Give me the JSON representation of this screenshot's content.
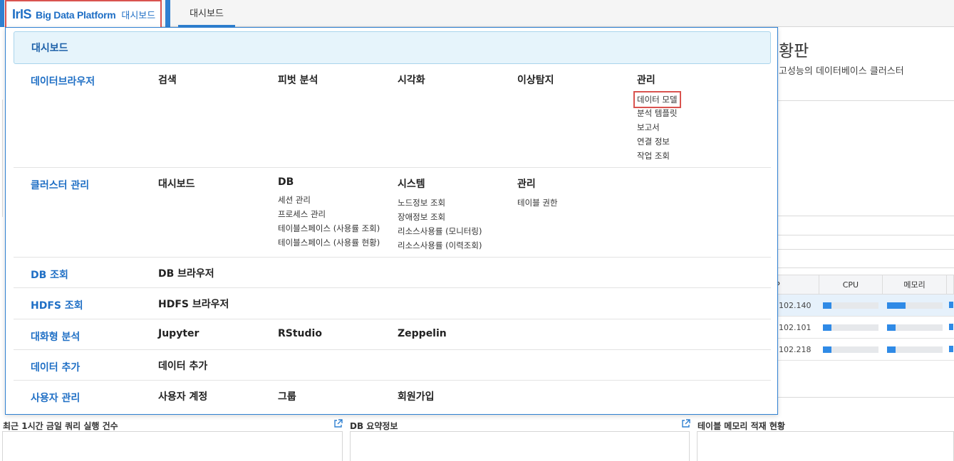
{
  "app": {
    "logo_text": "IrIS",
    "name": "Big Data Platform",
    "page": "대시보드"
  },
  "tabs": [
    {
      "label": "대시보드",
      "active": true
    }
  ],
  "colors": {
    "accent": "#2f80d1",
    "highlight": "#d9534f",
    "header_bg": "#e6f4fb",
    "section_title": "#1f6fc5"
  },
  "background": {
    "title_fragment": "황판",
    "subtitle_fragment": "고성능의 데이터베이스 클러스터",
    "table": {
      "columns": [
        "P",
        "CPU",
        "메모리"
      ],
      "rows": [
        {
          "ip": ".102.140",
          "cpu": 0.15,
          "mem": 0.33,
          "selected": true
        },
        {
          "ip": ".102.101",
          "cpu": 0.15,
          "mem": 0.15,
          "selected": false
        },
        {
          "ip": ".102.218",
          "cpu": 0.15,
          "mem": 0.15,
          "selected": false
        }
      ]
    },
    "panels": [
      {
        "title": "최근 1시간 금일 쿼리 실행 건수"
      },
      {
        "title": "DB 요약정보"
      },
      {
        "title": "테이블 메모리 적재 현황"
      }
    ]
  },
  "menu": {
    "header": "대시보드",
    "sections": [
      {
        "title": "데이터브라우저",
        "columns": [
          {
            "head": "검색",
            "items": []
          },
          {
            "head": "피벗 분석",
            "items": []
          },
          {
            "head": "시각화",
            "items": []
          },
          {
            "head": "이상탐지",
            "items": []
          },
          {
            "head": "관리",
            "items": [
              "데이터 모델",
              "분석 템플릿",
              "보고서",
              "연결 정보",
              "작업 조회"
            ]
          }
        ]
      },
      {
        "title": "클러스터 관리",
        "columns": [
          {
            "head": "대시보드",
            "items": []
          },
          {
            "head": "DB",
            "items": [
              "세션 관리",
              "프로세스 관리",
              "테이블스페이스 (사용률 조회)",
              "테이블스페이스 (사용률 현황)"
            ]
          },
          {
            "head": "시스템",
            "items": [
              "노드정보 조회",
              "장애정보 조회",
              "리소스사용률 (모니터링)",
              "리소스사용률 (이력조회)"
            ]
          },
          {
            "head": "관리",
            "items": [
              "테이블 권한"
            ]
          }
        ]
      },
      {
        "title": "DB 조회",
        "columns": [
          {
            "head": "DB 브라우저",
            "items": []
          }
        ]
      },
      {
        "title": "HDFS 조회",
        "columns": [
          {
            "head": "HDFS 브라우저",
            "items": []
          }
        ]
      },
      {
        "title": "대화형 분석",
        "columns": [
          {
            "head": "Jupyter",
            "items": []
          },
          {
            "head": "RStudio",
            "items": []
          },
          {
            "head": "Zeppelin",
            "items": []
          }
        ]
      },
      {
        "title": "데이터 추가",
        "columns": [
          {
            "head": "데이터 추가",
            "items": []
          }
        ]
      },
      {
        "title": "사용자 관리",
        "columns": [
          {
            "head": "사용자 계정",
            "items": []
          },
          {
            "head": "그룹",
            "items": []
          },
          {
            "head": "회원가입",
            "items": []
          }
        ]
      }
    ]
  }
}
